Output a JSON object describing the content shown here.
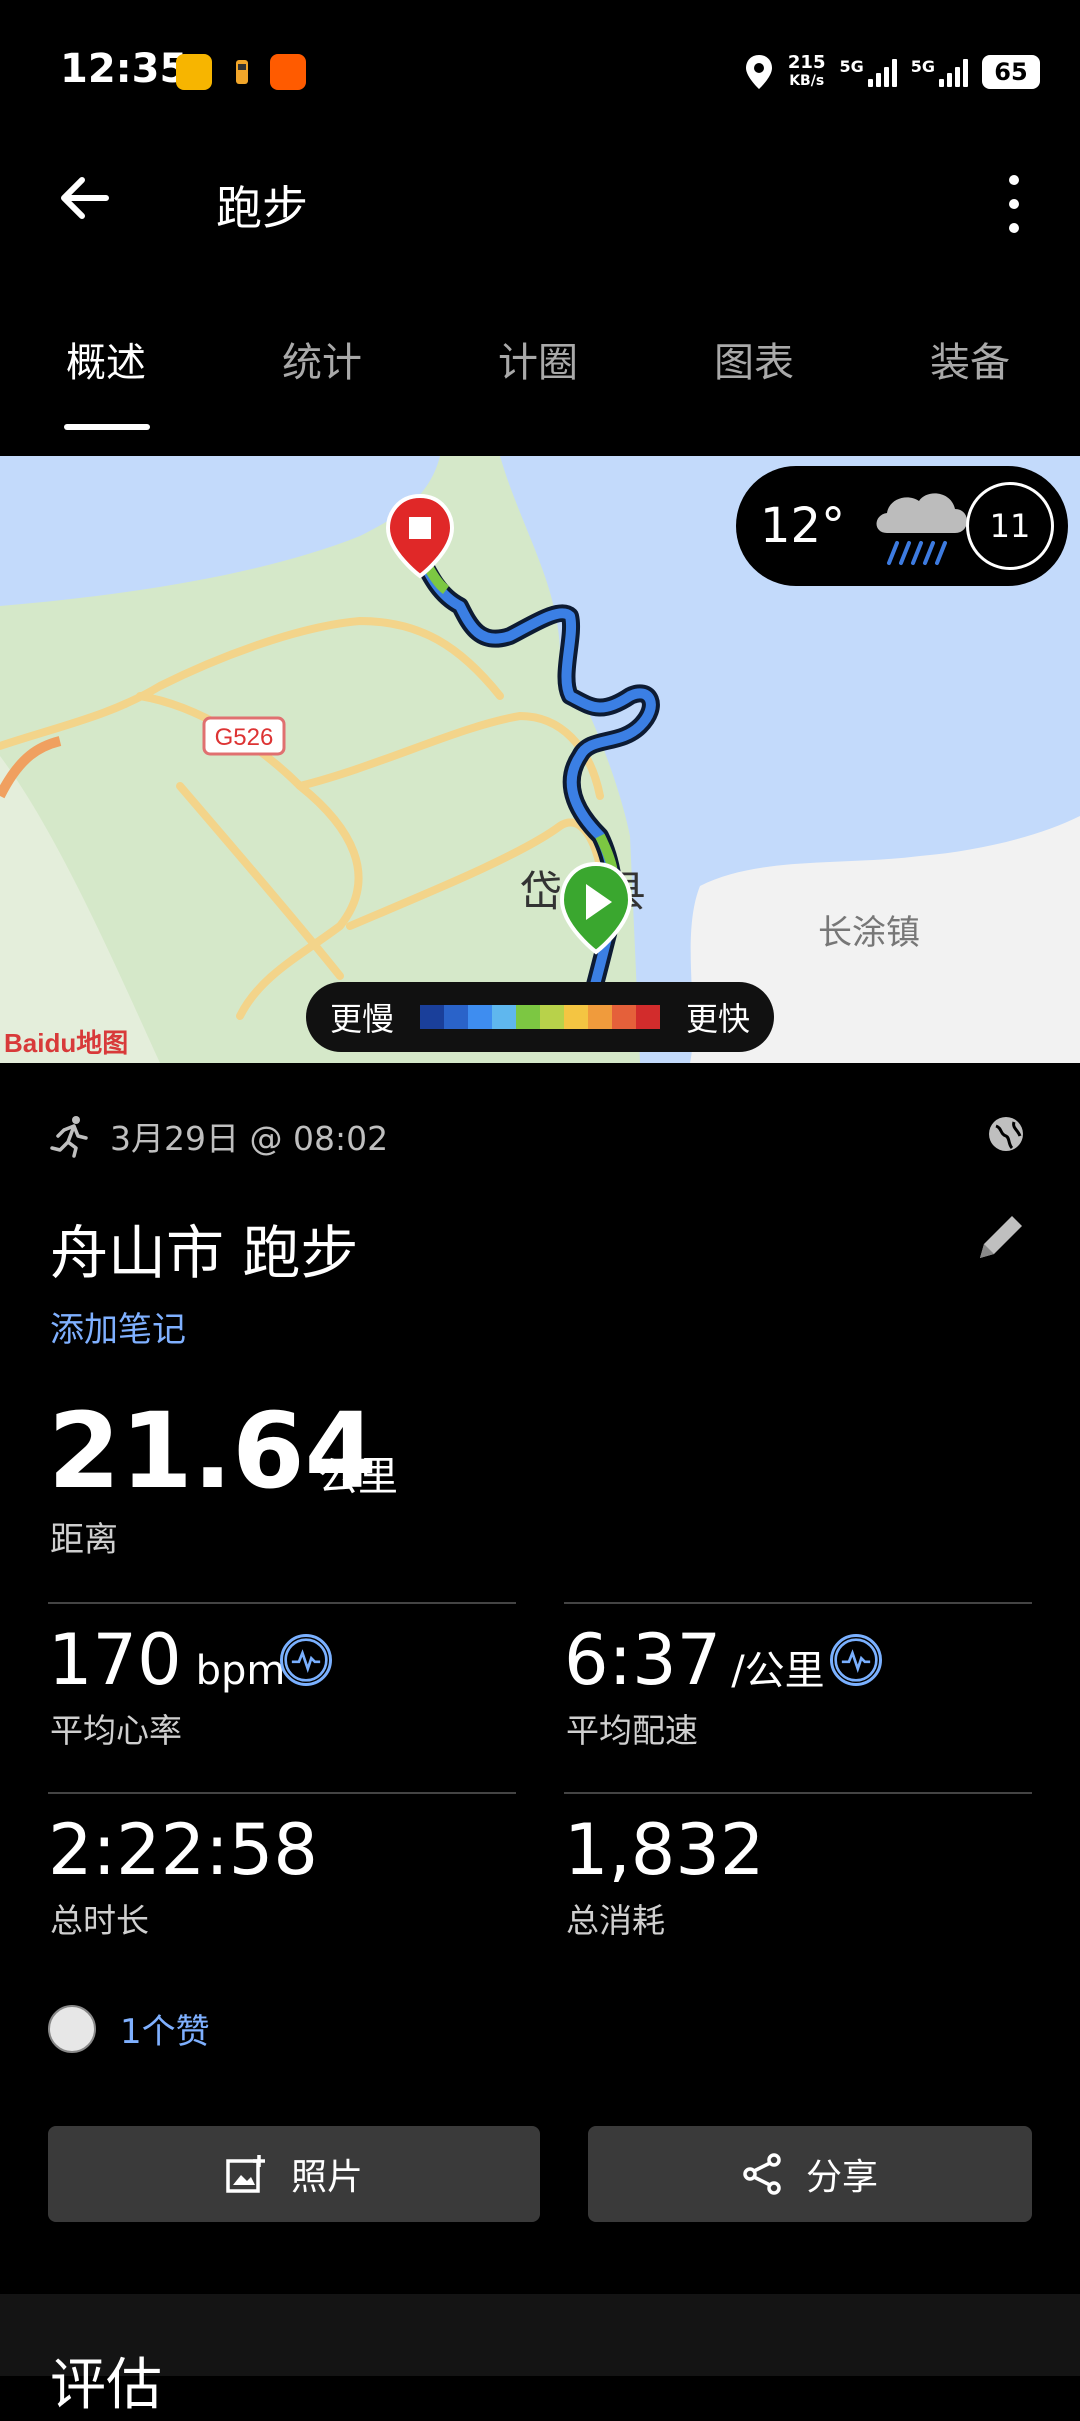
{
  "status": {
    "time": "12:35",
    "net_speed_value": "215",
    "net_speed_unit": "KB/s",
    "sim1": "5G",
    "sim2": "5G",
    "battery": "65"
  },
  "header": {
    "title": "跑步"
  },
  "tabs": [
    {
      "label": "概述",
      "active": true
    },
    {
      "label": "统计"
    },
    {
      "label": "计圈"
    },
    {
      "label": "图表"
    },
    {
      "label": "装备"
    }
  ],
  "map": {
    "road_label": "G526",
    "town1": "岱山县",
    "town2": "长涂镇",
    "brand": "Baidu地图",
    "weather_temp": "12°",
    "uv_index": "11",
    "legend_slow": "更慢",
    "legend_fast": "更快",
    "legend_colors": [
      "#1a3f9a",
      "#2a63c9",
      "#3e8df0",
      "#5fb7ee",
      "#7cc742",
      "#b8d24a",
      "#f4c542",
      "#f09b3c",
      "#e5603a",
      "#d22c2c"
    ]
  },
  "activity": {
    "date": "3月29日 @ 08:02",
    "title": "舟山市 跑步",
    "add_note": "添加笔记",
    "distance": "21.64",
    "distance_unit": "公里",
    "distance_label": "距离",
    "heart_rate": "170",
    "heart_rate_unit": "bpm",
    "heart_rate_label": "平均心率",
    "pace": "6:37",
    "pace_unit": "/公里",
    "pace_label": "平均配速",
    "duration": "2:22:58",
    "duration_label": "总时长",
    "calories": "1,832",
    "calories_label": "总消耗",
    "likes": "1个赞"
  },
  "buttons": {
    "photo": "照片",
    "share": "分享"
  },
  "section": {
    "evaluation": "评估"
  },
  "colors": {
    "accent": "#7fb0ff",
    "start_marker": "#3aa72f",
    "end_marker": "#e02828"
  }
}
